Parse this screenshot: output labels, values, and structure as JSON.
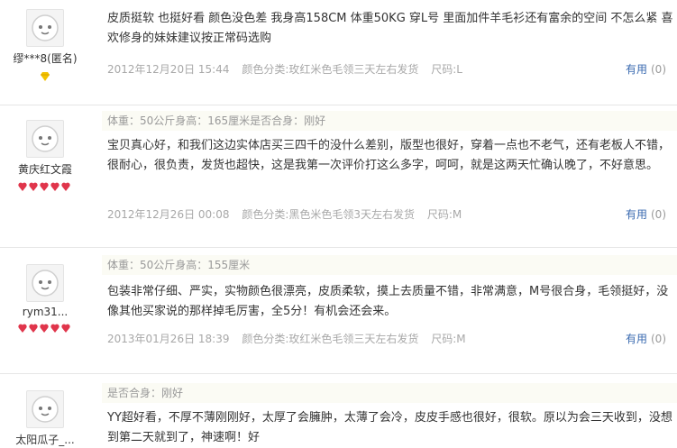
{
  "reviews": [
    {
      "user": "缪***8(匿名)",
      "badge": "diamond",
      "meta": "",
      "content": "皮质挺软 也挺好看 颜色没色差 我身高158CM 体重50KG 穿L号 里面加件羊毛衫还有富余的空间 不怎么紧 喜欢修身的妹妹建议按正常码选购",
      "date": "2012年12月20日 15:44",
      "color_category": "颜色分类:玫红米色毛领三天左右发货",
      "size": "尺码:L",
      "useful_label": "有用",
      "useful_count": "(0)"
    },
    {
      "user": "黄庆红文霞",
      "badge": "hearts",
      "meta": "体重：50公斤身高：165厘米是否合身：刚好",
      "content": "宝贝真心好，和我们这边实体店买三四千的没什么差别，版型也很好，穿着一点也不老气，还有老板人不错，很耐心，很负责，发货也超快，这是我第一次评价打这么多字，呵呵，就是这两天忙确认晚了，不好意思。",
      "date": "2012年12月26日 00:08",
      "color_category": "颜色分类:黑色米色毛领3天左右发货",
      "size": "尺码:M",
      "useful_label": "有用",
      "useful_count": "(0)"
    },
    {
      "user": "rym31...",
      "badge": "hearts",
      "meta": "体重：50公斤身高：155厘米",
      "content": "包装非常仔细、严实，实物颜色很漂亮，皮质柔软，摸上去质量不错，非常满意，M号很合身，毛领挺好，没像其他买家说的那样掉毛厉害，全5分！有机会还会来。",
      "date": "2013年01月26日 18:39",
      "color_category": "颜色分类:玫红米色毛领三天左右发货",
      "size": "尺码:M",
      "useful_label": "有用",
      "useful_count": "(0)"
    },
    {
      "user": "太阳瓜子_...",
      "badge": "",
      "meta": "是否合身：刚好",
      "content": "YY超好看，不厚不薄刚刚好，太厚了会臃肿，太薄了会冷，皮皮手感也很好，很软。原以为会三天收到，没想到第二天就到了，神速啊！好",
      "date": "",
      "color_category": "",
      "size": "",
      "useful_label": "",
      "useful_count": ""
    }
  ],
  "colors": {
    "heart": "#e0354b",
    "diamond": "#f2c200",
    "link": "#3a6ab0"
  }
}
